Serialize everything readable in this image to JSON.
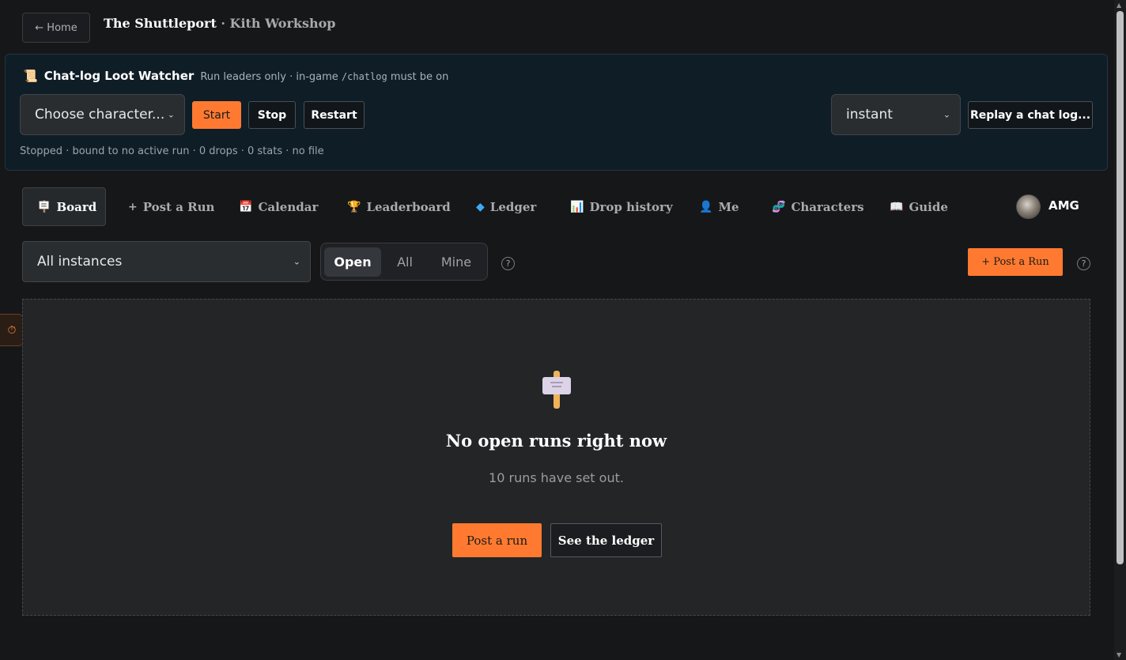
{
  "header": {
    "home_label": "← Home",
    "site_name": "The Shuttleport",
    "site_sub": " · Kith Workshop"
  },
  "watcher": {
    "icon": "scroll-icon",
    "title": "Chat-log Loot Watcher",
    "note_prefix": "Run leaders only · in-game",
    "note_code": "/chatlog",
    "note_suffix": "must be on",
    "character_select": "Choose character...",
    "start_label": "Start",
    "stop_label": "Stop",
    "restart_label": "Restart",
    "speed_select": "instant",
    "replay_label": "Replay a chat log...",
    "status": "Stopped · bound to no active run · 0 drops · 0 stats · no file"
  },
  "nav": {
    "items": [
      {
        "label": "Board",
        "icon": "signpost-icon"
      },
      {
        "label": "Post a Run",
        "icon": "plus-icon"
      },
      {
        "label": "Calendar",
        "icon": "calendar-icon"
      },
      {
        "label": "Leaderboard",
        "icon": "trophy-icon"
      },
      {
        "label": "Ledger",
        "icon": "diamond-icon"
      },
      {
        "label": "Drop history",
        "icon": "bar-chart-icon"
      },
      {
        "label": "Me",
        "icon": "user-icon"
      },
      {
        "label": "Characters",
        "icon": "dna-icon"
      },
      {
        "label": "Guide",
        "icon": "book-icon"
      }
    ],
    "user": "AMG"
  },
  "filters": {
    "instances": "All instances",
    "tabs": [
      "Open",
      "All",
      "Mine"
    ],
    "active_tab": "Open",
    "help": "?",
    "post_run_label": "+ Post a Run"
  },
  "empty_state": {
    "title": "No open runs right now",
    "subtitle": "10 runs have set out.",
    "post_label": "Post a run",
    "ledger_label": "See the ledger"
  },
  "colors": {
    "accent": "#ff7a30",
    "background": "#161719",
    "panel": "#0f1d26"
  }
}
